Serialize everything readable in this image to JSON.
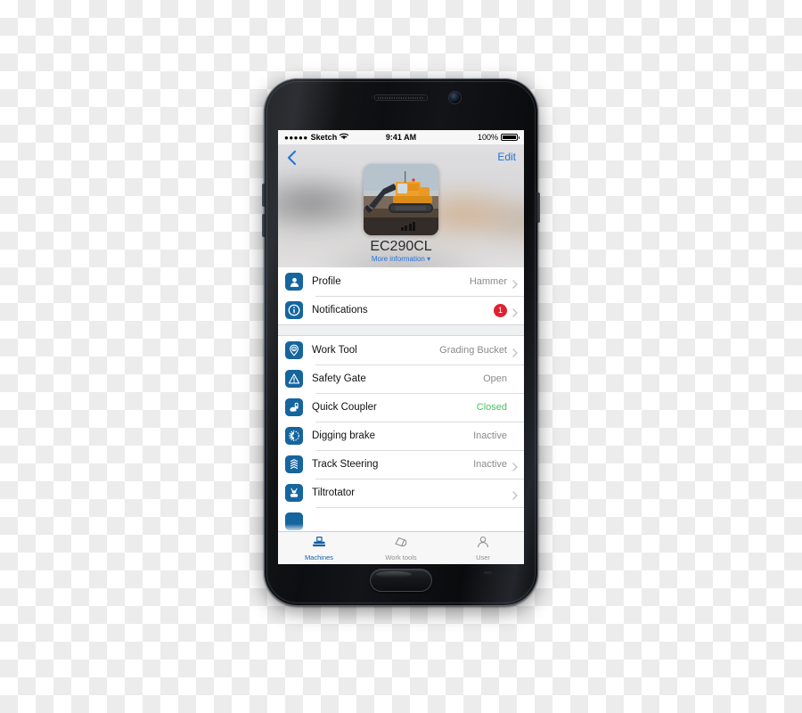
{
  "status_bar": {
    "signal_dots": "●●●●●",
    "carrier": "Sketch",
    "wifi_icon": "wifi-icon",
    "time": "9:41 AM",
    "battery_percent": "100%",
    "battery_icon": "battery-full-icon"
  },
  "header": {
    "back_icon": "back-chevron-icon",
    "edit_label": "Edit",
    "photo_alt": "excavator-photo",
    "signal_icon": "signal-bars-icon",
    "machine_name": "EC290CL",
    "more_information_label": "More information ▾"
  },
  "groups": [
    {
      "rows": [
        {
          "icon": "person-icon",
          "label": "Profile",
          "value": "Hammer",
          "chevron": true,
          "badge": null
        },
        {
          "icon": "info-icon",
          "label": "Notifications",
          "value": "",
          "chevron": true,
          "badge": "1"
        }
      ]
    },
    {
      "rows": [
        {
          "icon": "work-tool-icon",
          "label": "Work Tool",
          "value": "Grading Bucket",
          "chevron": true,
          "badge": null
        },
        {
          "icon": "warning-icon",
          "label": "Safety Gate",
          "value": "Open",
          "chevron": false,
          "badge": null
        },
        {
          "icon": "quick-coupler-icon",
          "label": "Quick Coupler",
          "value": "Closed",
          "chevron": false,
          "badge": null,
          "value_color": "green"
        },
        {
          "icon": "brake-icon",
          "label": "Digging brake",
          "value": "Inactive",
          "chevron": false,
          "badge": null
        },
        {
          "icon": "track-steering-icon",
          "label": "Track Steering",
          "value": "Inactive",
          "chevron": true,
          "badge": null
        },
        {
          "icon": "tiltrotator-icon",
          "label": "Tiltrotator",
          "value": "",
          "chevron": true,
          "badge": null
        }
      ]
    }
  ],
  "tabs": [
    {
      "icon": "excavator-icon",
      "label": "Machines",
      "active": true
    },
    {
      "icon": "work-tools-icon",
      "label": "Work tools",
      "active": false
    },
    {
      "icon": "user-icon",
      "label": "User",
      "active": false
    }
  ],
  "colors": {
    "accent_blue": "#2573d8",
    "icon_tile_blue": "#15659e",
    "badge_red": "#e0202e",
    "status_green": "#46c463",
    "tab_active": "#1560a8",
    "tab_inactive": "#8e8e93"
  }
}
